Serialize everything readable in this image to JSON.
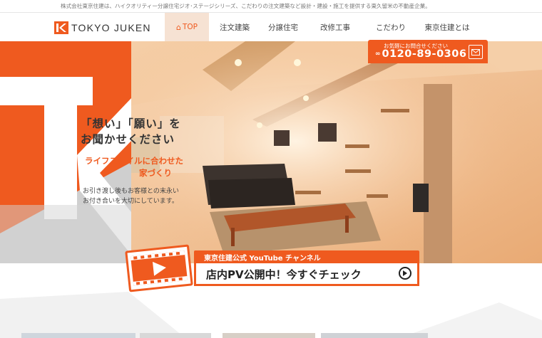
{
  "topbar": {
    "text": "株式会社東京住建は、ハイクオリティー分譲住宅ジオ･ステージシリーズ、こだわりの注文建築など設計・建設・施工を提供する東久留米の不動産企業。"
  },
  "header": {
    "logo_text": "TOKYO JUKEN",
    "nav": [
      {
        "label": "TOP",
        "icon": "home-icon"
      },
      {
        "label": "注文建築"
      },
      {
        "label": "分譲住宅"
      },
      {
        "label": "改修工事"
      },
      {
        "label": "こだわり"
      },
      {
        "label": "東京住建とは"
      }
    ],
    "contact": {
      "caption": "お気軽にお問合せください",
      "phone": "0120-89-0306",
      "freedial_icon": "freedial-icon",
      "mail_icon": "mail-icon"
    }
  },
  "hero": {
    "catch_line1": "「想い」「願い」を",
    "catch_line2": "お聞かせください",
    "sub_line1": "ライフスタイルに合わせた",
    "sub_line2": "家づくり",
    "body_line1": "お引き渡し後もお客様との末永い",
    "body_line2": "お付き合いを大切にしています。"
  },
  "youtube_banner": {
    "strip": "東京住建公式 YouTube チャンネル",
    "main": "店内PV公開中！今すぐチェック",
    "play_icon": "play-icon",
    "arrow_icon": "arrow-right-circle-icon"
  },
  "colors": {
    "accent": "#ef5a1f",
    "accent_light": "#f6e2d3",
    "grey": "#cccccc",
    "text": "#333333"
  }
}
